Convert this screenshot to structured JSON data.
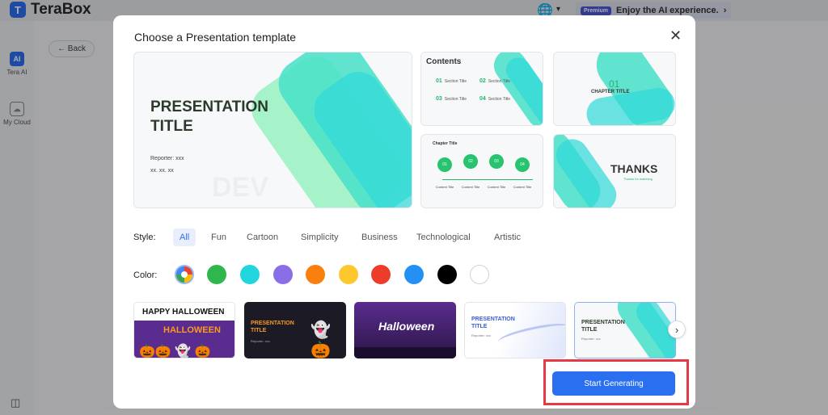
{
  "app": {
    "name": "TeraBox",
    "promo_badge": "Premium",
    "promo_text": "Enjoy the AI experience.",
    "back_label": "Back",
    "sidebar": [
      {
        "label": "Tera AI",
        "icon": "ai-icon",
        "glyph": "AI"
      },
      {
        "label": "My Cloud",
        "icon": "cloud-icon",
        "glyph": "☁"
      }
    ]
  },
  "modal": {
    "title": "Choose a Presentation template",
    "close_glyph": "✕",
    "templates": {
      "main": {
        "title": "PRESENTATION\nTITLE",
        "reporter": "Reporter: xxx",
        "date": "xx. xx. xx",
        "watermark": "DEV"
      },
      "contents": {
        "heading": "Contents",
        "items": [
          {
            "num": "01",
            "label": "Section Title"
          },
          {
            "num": "02",
            "label": "Section Title"
          },
          {
            "num": "03",
            "label": "Section Title"
          },
          {
            "num": "04",
            "label": "Section Title"
          }
        ]
      },
      "chapter": {
        "num": "01",
        "title": "CHAPTER TITLE"
      },
      "timeline": {
        "title": "Chapter Title",
        "node_label": "Content Title",
        "node_count": 4
      },
      "thanks": {
        "title": "THANKS",
        "subtitle": "Thanks for watching"
      }
    },
    "style_label": "Style:",
    "styles": [
      "All",
      "Fun",
      "Cartoon",
      "Simplicity",
      "Business",
      "Technological",
      "Artistic"
    ],
    "active_style": "All",
    "color_label": "Color:",
    "colors": [
      "all",
      "#2fb74e",
      "#20d6dc",
      "#8a6ee8",
      "#fa7f0f",
      "#fdc72e",
      "#ec3c2a",
      "#2490f4",
      "#000000",
      "#ffffff"
    ],
    "thumbnails": [
      {
        "title": "HAPPY HALLOWEEN",
        "subtitle": "HALLOWEEN"
      },
      {
        "title": "PRESENTATION TITLE",
        "subtitle": "Reporter: xxx"
      },
      {
        "title": "Halloween"
      },
      {
        "title": "PRESENTATION TITLE",
        "subtitle": "Reporter: xxx"
      },
      {
        "title": "PRESENTATION TITLE",
        "subtitle": "Reporter: xxx"
      }
    ],
    "next_glyph": "›",
    "start_label": "Start Generating"
  }
}
